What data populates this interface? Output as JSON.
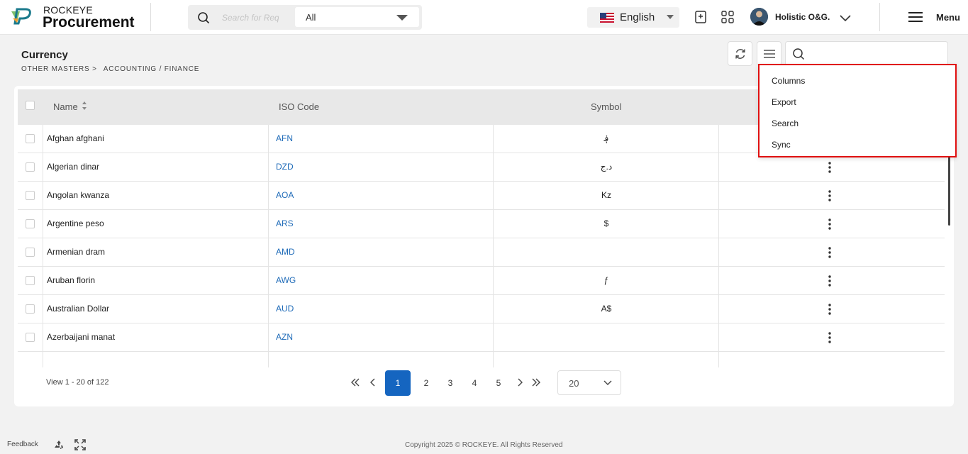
{
  "brand": {
    "top": "ROCKEYE",
    "main": "Procurement"
  },
  "header": {
    "search_placeholder": "Search for Request",
    "scope_value": "All",
    "language": "English",
    "user_name": "Holistic O&G.",
    "menu_label": "Menu"
  },
  "page": {
    "title": "Currency",
    "breadcrumb": [
      "OTHER MASTERS >",
      "ACCOUNTING / FINANCE"
    ]
  },
  "table": {
    "columns": [
      "Name",
      "ISO Code",
      "Symbol"
    ],
    "rows": [
      {
        "name": "Afghan afghani",
        "iso": "AFN",
        "symbol": "؋"
      },
      {
        "name": "Algerian dinar",
        "iso": "DZD",
        "symbol": "د.ج"
      },
      {
        "name": "Angolan kwanza",
        "iso": "AOA",
        "symbol": "Kz"
      },
      {
        "name": "Argentine peso",
        "iso": "ARS",
        "symbol": "$"
      },
      {
        "name": "Armenian dram",
        "iso": "AMD",
        "symbol": ""
      },
      {
        "name": "Aruban florin",
        "iso": "AWG",
        "symbol": "ƒ"
      },
      {
        "name": "Australian Dollar",
        "iso": "AUD",
        "symbol": "A$"
      },
      {
        "name": "Azerbaijani manat",
        "iso": "AZN",
        "symbol": ""
      }
    ]
  },
  "pager": {
    "view_text": "View 1 - 20 of 122",
    "pages": [
      "1",
      "2",
      "3",
      "4",
      "5"
    ],
    "active_page": "1",
    "page_size": "20"
  },
  "dropdown": {
    "items": [
      "Columns",
      "Export",
      "Search",
      "Sync"
    ]
  },
  "footer": {
    "feedback": "Feedback",
    "copyright": "Copyright 2025 © ROCKEYE. All Rights Reserved"
  },
  "colors": {
    "accent": "#1565c0",
    "link": "#1f6bb8",
    "highlight": "#e01010"
  }
}
